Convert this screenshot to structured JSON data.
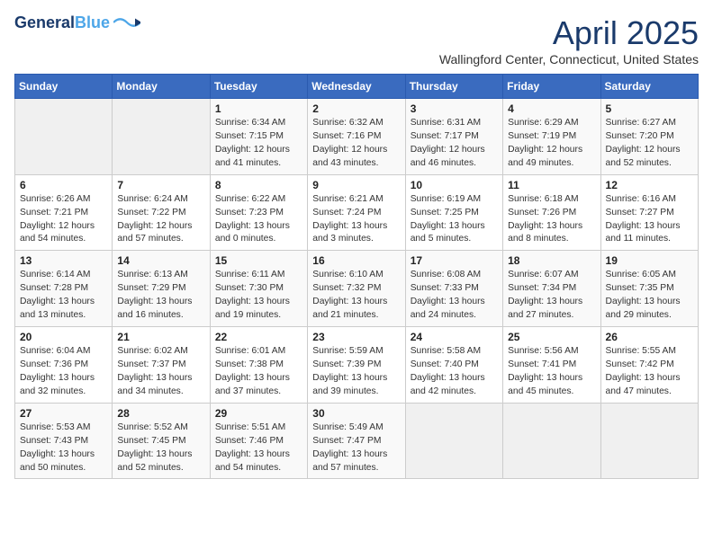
{
  "header": {
    "logo_line1": "General",
    "logo_line2": "Blue",
    "month": "April 2025",
    "location": "Wallingford Center, Connecticut, United States"
  },
  "days_of_week": [
    "Sunday",
    "Monday",
    "Tuesday",
    "Wednesday",
    "Thursday",
    "Friday",
    "Saturday"
  ],
  "weeks": [
    [
      {
        "num": "",
        "detail": ""
      },
      {
        "num": "",
        "detail": ""
      },
      {
        "num": "1",
        "detail": "Sunrise: 6:34 AM\nSunset: 7:15 PM\nDaylight: 12 hours\nand 41 minutes."
      },
      {
        "num": "2",
        "detail": "Sunrise: 6:32 AM\nSunset: 7:16 PM\nDaylight: 12 hours\nand 43 minutes."
      },
      {
        "num": "3",
        "detail": "Sunrise: 6:31 AM\nSunset: 7:17 PM\nDaylight: 12 hours\nand 46 minutes."
      },
      {
        "num": "4",
        "detail": "Sunrise: 6:29 AM\nSunset: 7:19 PM\nDaylight: 12 hours\nand 49 minutes."
      },
      {
        "num": "5",
        "detail": "Sunrise: 6:27 AM\nSunset: 7:20 PM\nDaylight: 12 hours\nand 52 minutes."
      }
    ],
    [
      {
        "num": "6",
        "detail": "Sunrise: 6:26 AM\nSunset: 7:21 PM\nDaylight: 12 hours\nand 54 minutes."
      },
      {
        "num": "7",
        "detail": "Sunrise: 6:24 AM\nSunset: 7:22 PM\nDaylight: 12 hours\nand 57 minutes."
      },
      {
        "num": "8",
        "detail": "Sunrise: 6:22 AM\nSunset: 7:23 PM\nDaylight: 13 hours\nand 0 minutes."
      },
      {
        "num": "9",
        "detail": "Sunrise: 6:21 AM\nSunset: 7:24 PM\nDaylight: 13 hours\nand 3 minutes."
      },
      {
        "num": "10",
        "detail": "Sunrise: 6:19 AM\nSunset: 7:25 PM\nDaylight: 13 hours\nand 5 minutes."
      },
      {
        "num": "11",
        "detail": "Sunrise: 6:18 AM\nSunset: 7:26 PM\nDaylight: 13 hours\nand 8 minutes."
      },
      {
        "num": "12",
        "detail": "Sunrise: 6:16 AM\nSunset: 7:27 PM\nDaylight: 13 hours\nand 11 minutes."
      }
    ],
    [
      {
        "num": "13",
        "detail": "Sunrise: 6:14 AM\nSunset: 7:28 PM\nDaylight: 13 hours\nand 13 minutes."
      },
      {
        "num": "14",
        "detail": "Sunrise: 6:13 AM\nSunset: 7:29 PM\nDaylight: 13 hours\nand 16 minutes."
      },
      {
        "num": "15",
        "detail": "Sunrise: 6:11 AM\nSunset: 7:30 PM\nDaylight: 13 hours\nand 19 minutes."
      },
      {
        "num": "16",
        "detail": "Sunrise: 6:10 AM\nSunset: 7:32 PM\nDaylight: 13 hours\nand 21 minutes."
      },
      {
        "num": "17",
        "detail": "Sunrise: 6:08 AM\nSunset: 7:33 PM\nDaylight: 13 hours\nand 24 minutes."
      },
      {
        "num": "18",
        "detail": "Sunrise: 6:07 AM\nSunset: 7:34 PM\nDaylight: 13 hours\nand 27 minutes."
      },
      {
        "num": "19",
        "detail": "Sunrise: 6:05 AM\nSunset: 7:35 PM\nDaylight: 13 hours\nand 29 minutes."
      }
    ],
    [
      {
        "num": "20",
        "detail": "Sunrise: 6:04 AM\nSunset: 7:36 PM\nDaylight: 13 hours\nand 32 minutes."
      },
      {
        "num": "21",
        "detail": "Sunrise: 6:02 AM\nSunset: 7:37 PM\nDaylight: 13 hours\nand 34 minutes."
      },
      {
        "num": "22",
        "detail": "Sunrise: 6:01 AM\nSunset: 7:38 PM\nDaylight: 13 hours\nand 37 minutes."
      },
      {
        "num": "23",
        "detail": "Sunrise: 5:59 AM\nSunset: 7:39 PM\nDaylight: 13 hours\nand 39 minutes."
      },
      {
        "num": "24",
        "detail": "Sunrise: 5:58 AM\nSunset: 7:40 PM\nDaylight: 13 hours\nand 42 minutes."
      },
      {
        "num": "25",
        "detail": "Sunrise: 5:56 AM\nSunset: 7:41 PM\nDaylight: 13 hours\nand 45 minutes."
      },
      {
        "num": "26",
        "detail": "Sunrise: 5:55 AM\nSunset: 7:42 PM\nDaylight: 13 hours\nand 47 minutes."
      }
    ],
    [
      {
        "num": "27",
        "detail": "Sunrise: 5:53 AM\nSunset: 7:43 PM\nDaylight: 13 hours\nand 50 minutes."
      },
      {
        "num": "28",
        "detail": "Sunrise: 5:52 AM\nSunset: 7:45 PM\nDaylight: 13 hours\nand 52 minutes."
      },
      {
        "num": "29",
        "detail": "Sunrise: 5:51 AM\nSunset: 7:46 PM\nDaylight: 13 hours\nand 54 minutes."
      },
      {
        "num": "30",
        "detail": "Sunrise: 5:49 AM\nSunset: 7:47 PM\nDaylight: 13 hours\nand 57 minutes."
      },
      {
        "num": "",
        "detail": ""
      },
      {
        "num": "",
        "detail": ""
      },
      {
        "num": "",
        "detail": ""
      }
    ]
  ]
}
